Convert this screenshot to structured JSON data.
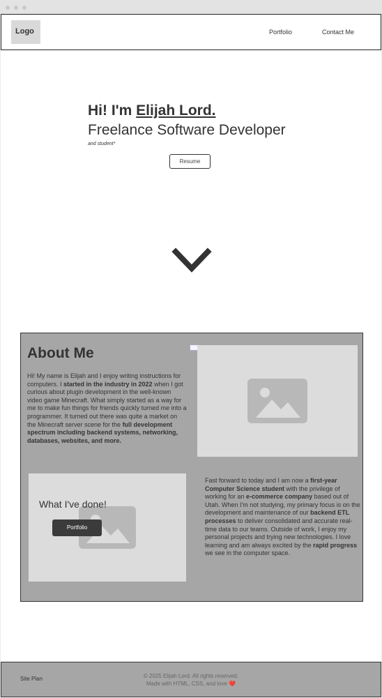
{
  "nav": {
    "logo": "Logo",
    "links": [
      {
        "label": "Portfolio"
      },
      {
        "label": "Contact Me"
      }
    ]
  },
  "hero": {
    "greeting": "Hi! I'm ",
    "name": "Elijah Lord.",
    "role": "Freelance Software Developer",
    "note": "and student*",
    "resume_label": "Resume"
  },
  "about": {
    "title": "About Me",
    "p1": {
      "t1": "Hi! My name is Elijah and I enjoy writing instructions for computers. I ",
      "b1": "started in the industry in 2022",
      "t2": " when I got curious about plugin development in the well-known video game Minecraft. What simply started as a way for me to make fun things for friends quickly turned me into a programmer. It turned out there was quite a market on the Minecraft server scene for the ",
      "b2": "full development spectrum including backend systems, networking, databases, websites, and more."
    },
    "p2": {
      "t1": "Fast forward to today and I am now a ",
      "b1": "first-year Computer Science student",
      "t2": " with the privilege of working for an ",
      "b2": "e-commerce company",
      "t3": " based out of Utah. When I'm not studying, my primary focus is on the development and maintenance of our ",
      "b3": "backend ETL processes",
      "t4": " to deliver consolidated and accurate real-time data to our teams. Outside of work, I enjoy my personal projects and trying new technologies. I love learning and am always excited by the ",
      "b4": "rapid progress",
      "t5": " we see in the computer space."
    },
    "work": {
      "title": "What I've done!",
      "button": "Portfolio"
    }
  },
  "footer": {
    "site_plan": "Site Plan",
    "copyright": "© 2025 Elijah Lord. All rights reserved.",
    "made_with": "Made with HTML, CSS, and love ",
    "heart": "❤️"
  },
  "colors": {
    "section_bg": "#a6a6a6",
    "placeholder_bg": "#dcdcdc",
    "placeholder_icon": "#b8b8b8",
    "button_dark": "#3b3b3b"
  }
}
